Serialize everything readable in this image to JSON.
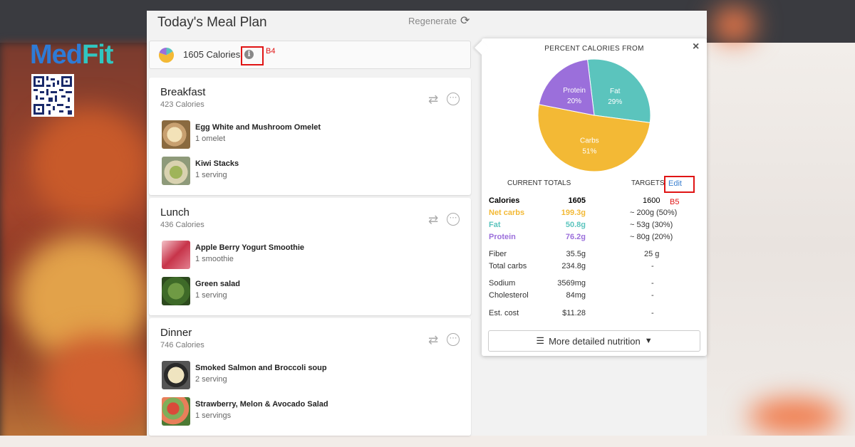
{
  "brand": {
    "med": "Med",
    "fit": "Fit"
  },
  "plan": {
    "title": "Today's Meal Plan",
    "regenerate_label": "Regenerate",
    "calories_summary": "1605 Calories",
    "info_icon": "i"
  },
  "annotations": {
    "b4": "B4",
    "b5": "B5"
  },
  "meals": [
    {
      "title": "Breakfast",
      "calories": "423 Calories",
      "foods": [
        {
          "name": "Egg White and Mushroom Omelet",
          "qty": "1   omelet"
        },
        {
          "name": "Kiwi Stacks",
          "qty": "1   serving"
        }
      ]
    },
    {
      "title": "Lunch",
      "calories": "436 Calories",
      "foods": [
        {
          "name": "Apple Berry Yogurt Smoothie",
          "qty": "1   smoothie"
        },
        {
          "name": "Green salad",
          "qty": "1   serving"
        }
      ]
    },
    {
      "title": "Dinner",
      "calories": "746 Calories",
      "foods": [
        {
          "name": "Smoked Salmon and Broccoli soup",
          "qty": "2   serving"
        },
        {
          "name": "Strawberry, Melon & Avocado Salad",
          "qty": "1   servings"
        }
      ]
    }
  ],
  "icons": {
    "swap": "swap-icon",
    "more": "more-options-icon",
    "close": "close-icon",
    "list": "list-icon",
    "chevron": "chevron-down-icon",
    "refresh": "refresh-icon"
  },
  "nutrition": {
    "pie_title": "PERCENT CALORIES FROM",
    "close": "×",
    "slices": [
      {
        "name": "Fat",
        "pct": "29%",
        "value": 29,
        "color": "#5bc4bd"
      },
      {
        "name": "Carbs",
        "pct": "51%",
        "value": 51,
        "color": "#f3b935"
      },
      {
        "name": "Protein",
        "pct": "20%",
        "value": 20,
        "color": "#9b6fdb"
      }
    ],
    "current_totals_label": "CURRENT TOTALS",
    "targets_label": "TARGETS",
    "edit_label": "Edit",
    "rows_main": [
      {
        "label": "Calories",
        "current": "1605",
        "target": "1600"
      },
      {
        "label": "Net carbs",
        "current": "199.3g",
        "target": "~ 200g (50%)"
      },
      {
        "label": "Fat",
        "current": "50.8g",
        "target": "~ 53g (30%)"
      },
      {
        "label": "Protein",
        "current": "76.2g",
        "target": "~ 80g (20%)"
      }
    ],
    "rows_extra": [
      {
        "label": "Fiber",
        "current": "35.5g",
        "target": "25 g"
      },
      {
        "label": "Total carbs",
        "current": "234.8g",
        "target": "-"
      },
      {
        "label": "Sodium",
        "current": "3569mg",
        "target": "-"
      },
      {
        "label": "Cholesterol",
        "current": "84mg",
        "target": "-"
      },
      {
        "label": "Est. cost",
        "current": "$11.28",
        "target": "-"
      }
    ],
    "more_label": "More detailed nutrition"
  },
  "colors": {
    "carbs": "#f3b935",
    "fat": "#5bc4bd",
    "protein": "#9b6fdb",
    "annotation_red": "#e01414",
    "link_blue": "#3a7fd0"
  }
}
